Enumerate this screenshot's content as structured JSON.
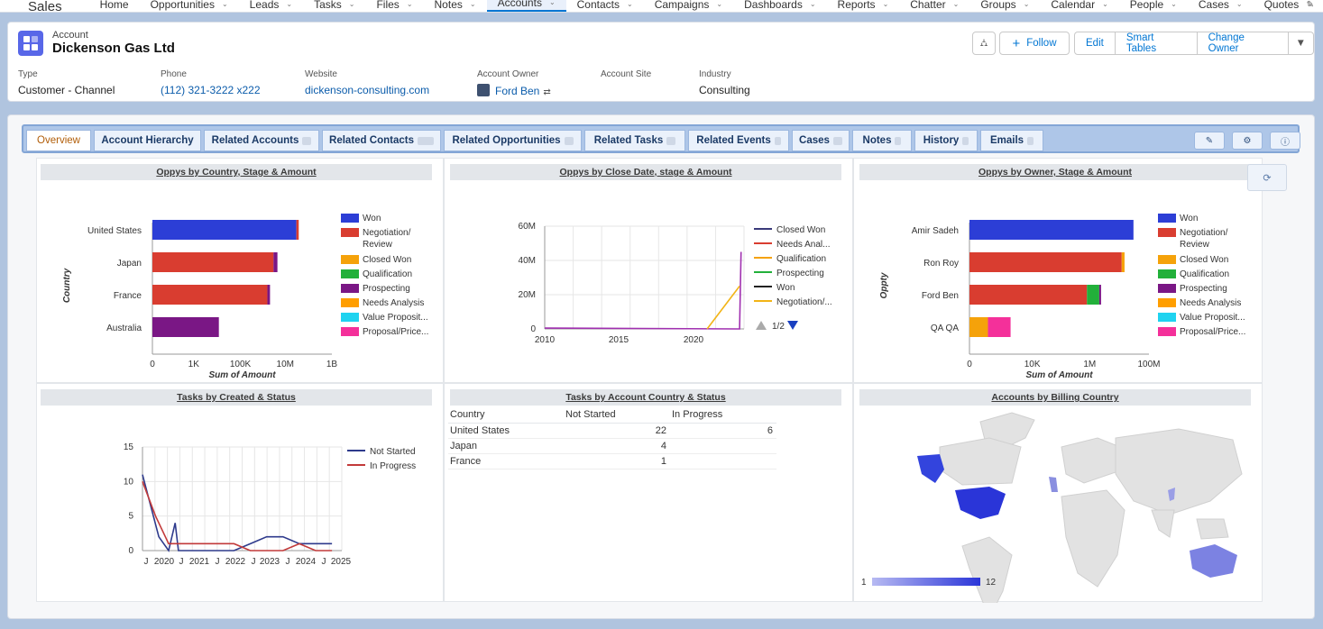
{
  "nav": {
    "app": "Sales",
    "items": [
      "Home",
      "Opportunities",
      "Leads",
      "Tasks",
      "Files",
      "Notes",
      "Accounts",
      "Contacts",
      "Campaigns",
      "Dashboards",
      "Reports",
      "Chatter",
      "Groups",
      "Calendar",
      "People",
      "Cases",
      "Quotes"
    ],
    "active": "Accounts"
  },
  "header": {
    "object_label": "Account",
    "name": "Dickenson Gas Ltd",
    "buttons": {
      "follow": "Follow",
      "edit": "Edit",
      "smart_tables": "Smart Tables",
      "change_owner": "Change Owner"
    },
    "fields": {
      "type": {
        "label": "Type",
        "value": "Customer - Channel"
      },
      "phone": {
        "label": "Phone",
        "value": "(112) 321-3222 x222"
      },
      "website": {
        "label": "Website",
        "value": "dickenson-consulting.com"
      },
      "owner": {
        "label": "Account Owner",
        "value": "Ford Ben"
      },
      "site": {
        "label": "Account Site",
        "value": ""
      },
      "industry": {
        "label": "Industry",
        "value": "Consulting"
      }
    }
  },
  "tabs": [
    "Overview",
    "Account Hierarchy",
    "Related Accounts",
    "Related Contacts",
    "Related Opportunities",
    "Related Tasks",
    "Related Events",
    "Cases",
    "Notes",
    "History",
    "Emails"
  ],
  "stage_colors": {
    "Won": "#2c3ed6",
    "Negotiation/ Review": "#d93d30",
    "Closed Won": "#f5a20a",
    "Qualification": "#22b03a",
    "Prospecting": "#7a1785",
    "Needs Analysis": "#ff9e00",
    "Value Proposit...": "#1fd3f0",
    "Proposal/Price...": "#f4309a"
  },
  "chart_data": [
    {
      "type": "bar",
      "title": "Oppys by Country, Stage & Amount",
      "xlabel": "Sum of Amount",
      "ylabel": "Country",
      "x_scale": "log",
      "x_ticks": [
        "0",
        "1K",
        "100K",
        "10M",
        "1B"
      ],
      "categories": [
        "United States",
        "Japan",
        "France",
        "Australia"
      ],
      "legend": [
        "Won",
        "Negotiation/ Review",
        "Closed Won",
        "Qualification",
        "Prospecting",
        "Needs Analysis",
        "Value Proposit...",
        "Proposal/Price..."
      ],
      "series": [
        {
          "name": "Won",
          "values": [
            30000000,
            0,
            0,
            0
          ]
        },
        {
          "name": "Negotiation/ Review",
          "values": [
            8000000,
            3000000,
            1600000,
            0
          ]
        },
        {
          "name": "Prospecting",
          "values": [
            0,
            1500000,
            500000,
            12000
          ]
        }
      ]
    },
    {
      "type": "line",
      "title": "Oppys by Close Date, stage & Amount",
      "xlim": [
        2010,
        2023.5
      ],
      "ylim": [
        0,
        60000000
      ],
      "x_ticks": [
        "2010",
        "2015",
        "2020"
      ],
      "y_ticks": [
        "0",
        "20M",
        "40M",
        "60M"
      ],
      "legend": [
        "Closed Won",
        "Needs Anal...",
        "Qualification",
        "Prospecting",
        "Won",
        "Negotiation/..."
      ],
      "legend_page": "1/2",
      "series": [
        {
          "name": "Prospecting",
          "x": [
            2010,
            2023,
            2023.2,
            2023.3
          ],
          "y": [
            500000,
            0,
            0,
            45000000
          ]
        },
        {
          "name": "Negotiation/...",
          "x": [
            2021,
            2023.2
          ],
          "y": [
            0,
            25000000
          ]
        }
      ]
    },
    {
      "type": "bar",
      "title": "Oppys by Owner, Stage & Amount",
      "xlabel": "Sum of Amount",
      "ylabel": "Oppty",
      "x_scale": "log",
      "x_ticks": [
        "0",
        "10K",
        "1M",
        "100M"
      ],
      "categories": [
        "Amir Sadeh",
        "Ron Roy",
        "Ford Ben",
        "QA QA"
      ],
      "legend": [
        "Won",
        "Negotiation/ Review",
        "Closed Won",
        "Qualification",
        "Prospecting",
        "Needs Analysis",
        "Value Proposit...",
        "Proposal/Price..."
      ],
      "series": [
        {
          "name": "Won",
          "values": [
            30000000,
            0,
            0,
            0
          ]
        },
        {
          "name": "Negotiation/ Review",
          "values": [
            0,
            12000000,
            800000,
            0
          ]
        },
        {
          "name": "Closed Won",
          "values": [
            0,
            3000000,
            0,
            15
          ]
        },
        {
          "name": "Qualification",
          "values": [
            0,
            0,
            1300000,
            0
          ]
        },
        {
          "name": "Prospecting",
          "values": [
            0,
            0,
            200000,
            0
          ]
        },
        {
          "name": "Proposal/Price...",
          "values": [
            0,
            0,
            0,
            400
          ]
        }
      ]
    },
    {
      "type": "line",
      "title": "Tasks by Created & Status",
      "xlim": [
        2019.2,
        2025.3
      ],
      "ylim": [
        0,
        15
      ],
      "x_ticks": [
        "J",
        "2020",
        "J",
        "2021",
        "J",
        "2022",
        "J",
        "2023",
        "J",
        "2024",
        "J",
        "2025"
      ],
      "y_ticks": [
        "0",
        "5",
        "10",
        "15"
      ],
      "legend": [
        "Not Started",
        "In Progress"
      ],
      "series": [
        {
          "name": "Not Started",
          "x": [
            2019.2,
            2019.7,
            2020.0,
            2020.2,
            2020.3,
            2020.35,
            2021.0,
            2022.0,
            2022.5,
            2023.0,
            2023.5,
            2024.0,
            2024.5,
            2025.0
          ],
          "y": [
            11,
            2,
            0,
            4,
            0,
            0,
            0,
            0,
            1,
            2,
            2,
            1,
            1,
            1
          ]
        },
        {
          "name": "In Progress",
          "x": [
            2019.2,
            2019.6,
            2020.0,
            2020.3,
            2021.0,
            2022.0,
            2022.5,
            2023.0,
            2023.5,
            2024.0,
            2024.5,
            2025.0
          ],
          "y": [
            10,
            5,
            1,
            1,
            1,
            1,
            0,
            0,
            0,
            1,
            0,
            0
          ]
        }
      ]
    },
    {
      "type": "table",
      "title": "Tasks by Account Country & Status",
      "columns": [
        "Country",
        "Not Started",
        "In Progress"
      ],
      "rows": [
        [
          "United States",
          "22",
          "6"
        ],
        [
          "Japan",
          "4",
          ""
        ],
        [
          "France",
          "1",
          ""
        ]
      ]
    },
    {
      "type": "heatmap",
      "title": "Accounts by Billing Country",
      "range": [
        "1",
        "12"
      ]
    }
  ]
}
